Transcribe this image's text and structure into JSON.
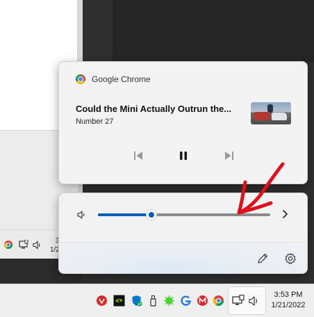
{
  "media": {
    "app_name": "Google Chrome",
    "title": "Could the Mini Actually Outrun the...",
    "subtitle": "Number 27",
    "controls": [
      "previous-track",
      "pause",
      "next-track"
    ]
  },
  "volume": {
    "level_fraction": 0.31,
    "accent_color": "#005fb8"
  },
  "background_tray": {
    "time_partial": "3",
    "date_partial": "1/2"
  },
  "taskbar": {
    "tray_icons": [
      "lastpass-icon",
      "nvidia-icon",
      "windows-security-icon",
      "usb-icon",
      "razer-icon",
      "logitech-icon",
      "mega-icon",
      "chrome-icon"
    ],
    "time": "3:53 PM",
    "date": "1/21/2022"
  },
  "annotation": {
    "color": "#e0101a",
    "shape": "hand-drawn arrow pointing down-left at volume slider"
  }
}
